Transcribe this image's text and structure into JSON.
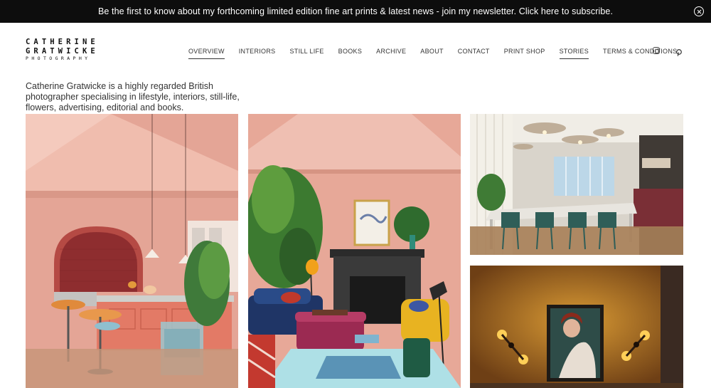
{
  "announcement": {
    "text": "Be the first to know about my forthcoming limited edition fine art prints & latest news - join my newsletter. Click here to subscribe.",
    "close_icon": "close-circle-icon"
  },
  "logo": {
    "line1": "CATHERINE",
    "line2": "GRATWICKE",
    "line3": "PHOTOGRAPHY"
  },
  "nav": {
    "items": [
      {
        "label": "OVERVIEW",
        "active": true
      },
      {
        "label": "INTERIORS",
        "active": false
      },
      {
        "label": "STILL LIFE",
        "active": false
      },
      {
        "label": "BOOKS",
        "active": false
      },
      {
        "label": "ARCHIVE",
        "active": false
      },
      {
        "label": "ABOUT",
        "active": false
      },
      {
        "label": "CONTACT",
        "active": false
      },
      {
        "label": "PRINT SHOP",
        "active": false
      },
      {
        "label": "STORIES",
        "active": true
      },
      {
        "label": "TERMS & CONDITIONS",
        "active": false
      }
    ]
  },
  "social": {
    "icons": [
      "instagram-icon",
      "pinterest-icon"
    ]
  },
  "intro": {
    "text": "Catherine Gratwicke is a highly regarded British photographer specialising in lifestyle, interiors, still-life, flowers, advertising, editorial and books."
  },
  "gallery": {
    "photos": [
      {
        "subject": "pink-kitchen-photo"
      },
      {
        "subject": "pink-living-room-photo"
      },
      {
        "subject": "workspace-interior-photo"
      },
      {
        "subject": "portrait-wall-lights-photo"
      }
    ]
  },
  "colors": {
    "announce_bg": "#0d0d0d",
    "page_bg": "#ffffff",
    "text": "#333333",
    "pink_wall": "#e6a393",
    "brass": "#c9861f"
  }
}
